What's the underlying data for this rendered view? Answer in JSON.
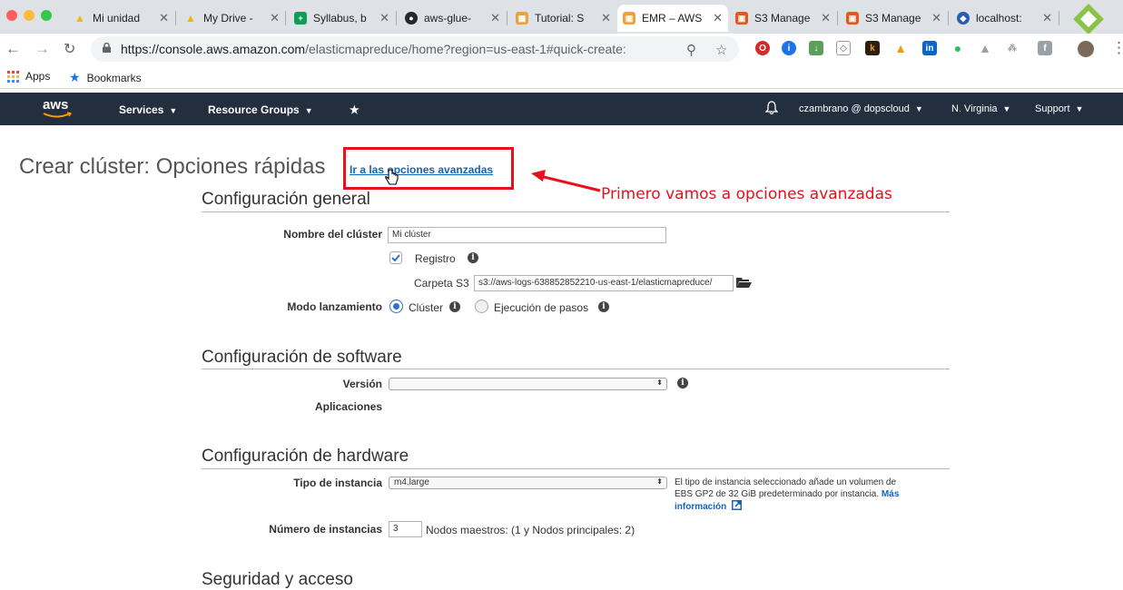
{
  "browser": {
    "tabs": [
      {
        "title": "Mi unidad",
        "color": "#f4b400",
        "letter": "▲"
      },
      {
        "title": "My Drive -",
        "color": "#f4b400",
        "letter": "▲"
      },
      {
        "title": "Syllabus, b",
        "color": "#0f9d58",
        "letter": "+"
      },
      {
        "title": "aws-glue-",
        "color": "#24292e",
        "letter": "●"
      },
      {
        "title": "Tutorial: S",
        "color": "#e8a33d",
        "letter": "▦"
      },
      {
        "title": "EMR – AWS",
        "color": "#f2a13a",
        "letter": "▣"
      },
      {
        "title": "S3 Manage",
        "color": "#e05a1e",
        "letter": "▣"
      },
      {
        "title": "S3 Manage",
        "color": "#e05a1e",
        "letter": "▣"
      },
      {
        "title": "localhost:",
        "color": "#2a5bb0",
        "letter": "◆"
      }
    ],
    "url_main": "https://console.aws.amazon.com",
    "url_path": "/elasticmapreduce/home?region=us-east-1#quick-create:",
    "bookmarks": {
      "apps": "Apps",
      "bookmarks": "Bookmarks"
    }
  },
  "aws_nav": {
    "logo": "aws",
    "services": "Services",
    "resource_groups": "Resource Groups",
    "pin": "★",
    "bell": "🔔",
    "account": "czambrano @ dopscloud",
    "region": "N. Virginia",
    "support": "Support"
  },
  "page": {
    "title": "Crear clúster: Opciones rápidas",
    "advanced_link": "Ir a las opciones avanzadas",
    "annotation": "Primero vamos a opciones avanzadas"
  },
  "general": {
    "title": "Configuración general",
    "cluster_name_label": "Nombre del clúster",
    "cluster_name_value": "Mi clúster",
    "logging_label": "Registro",
    "s3_folder_label": "Carpeta S3",
    "s3_folder_value": "s3://aws-logs-638852852210-us-east-1/elasticmapreduce/",
    "launch_mode_label": "Modo lanzamiento",
    "mode_cluster": "Clúster",
    "mode_steps": "Ejecución de pasos"
  },
  "software": {
    "title": "Configuración de software",
    "version_label": "Versión",
    "version_value": "",
    "applications_label": "Aplicaciones"
  },
  "hardware": {
    "title": "Configuración de hardware",
    "instance_type_label": "Tipo de instancia",
    "instance_type_value": "m4.large",
    "instance_help_1": "El tipo de instancia seleccionado añade un volumen de",
    "instance_help_2": "EBS GP2 de 32 GiB predeterminado por instancia.",
    "instance_help_more_1": "Más",
    "instance_help_more_2": "información",
    "instance_count_label": "Número de instancias",
    "instance_count_value": "3",
    "instance_count_note": "Nodos maestros: (1 y Nodos principales: 2)"
  },
  "security": {
    "title": "Seguridad y acceso"
  }
}
